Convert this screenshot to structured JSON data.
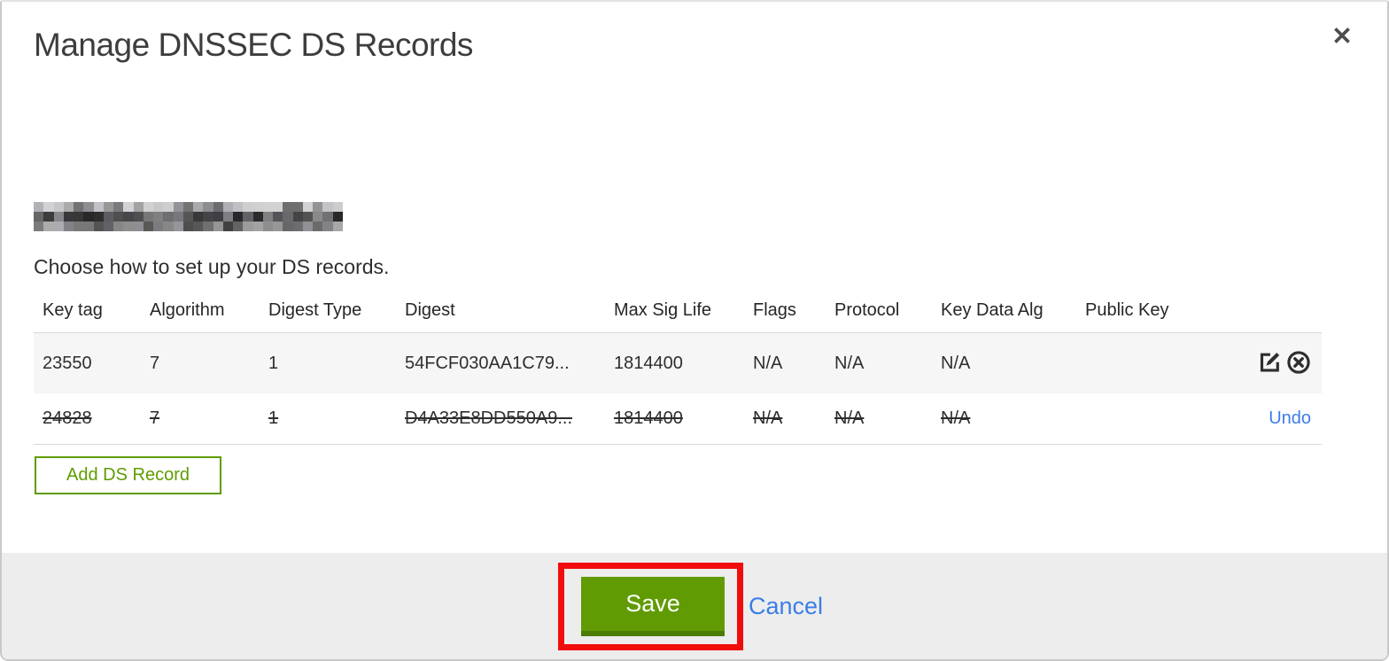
{
  "modal": {
    "title": "Manage DNSSEC DS Records",
    "subtitle": "Choose how to set up your DS records.",
    "domain_redacted": true
  },
  "table": {
    "columns": [
      "Key tag",
      "Algorithm",
      "Digest Type",
      "Digest",
      "Max Sig Life",
      "Flags",
      "Protocol",
      "Key Data Alg",
      "Public Key"
    ],
    "rows": [
      {
        "cells": [
          "23550",
          "7",
          "1",
          "54FCF030AA1C79...",
          "1814400",
          "N/A",
          "N/A",
          "N/A",
          ""
        ],
        "state": "normal",
        "actions": [
          "edit",
          "delete"
        ]
      },
      {
        "cells": [
          "24828",
          "7",
          "1",
          "D4A33E8DD550A9...",
          "1814400",
          "N/A",
          "N/A",
          "N/A",
          ""
        ],
        "state": "deleted",
        "undo_label": "Undo"
      }
    ]
  },
  "buttons": {
    "add_ds_record": "Add DS Record",
    "save": "Save",
    "cancel": "Cancel"
  },
  "icons": {
    "close": "close-icon",
    "edit": "edit-pencil-square-icon",
    "delete": "delete-circle-x-icon"
  },
  "colors": {
    "brand_green": "#619b03",
    "brand_green_dark": "#4c7c02",
    "outline_green": "#5e9c00",
    "link_blue": "#3b7de8",
    "annotation_red": "#f10d0d",
    "footer_bg": "#ededed",
    "row_stripe_bg": "#f6f6f6"
  }
}
